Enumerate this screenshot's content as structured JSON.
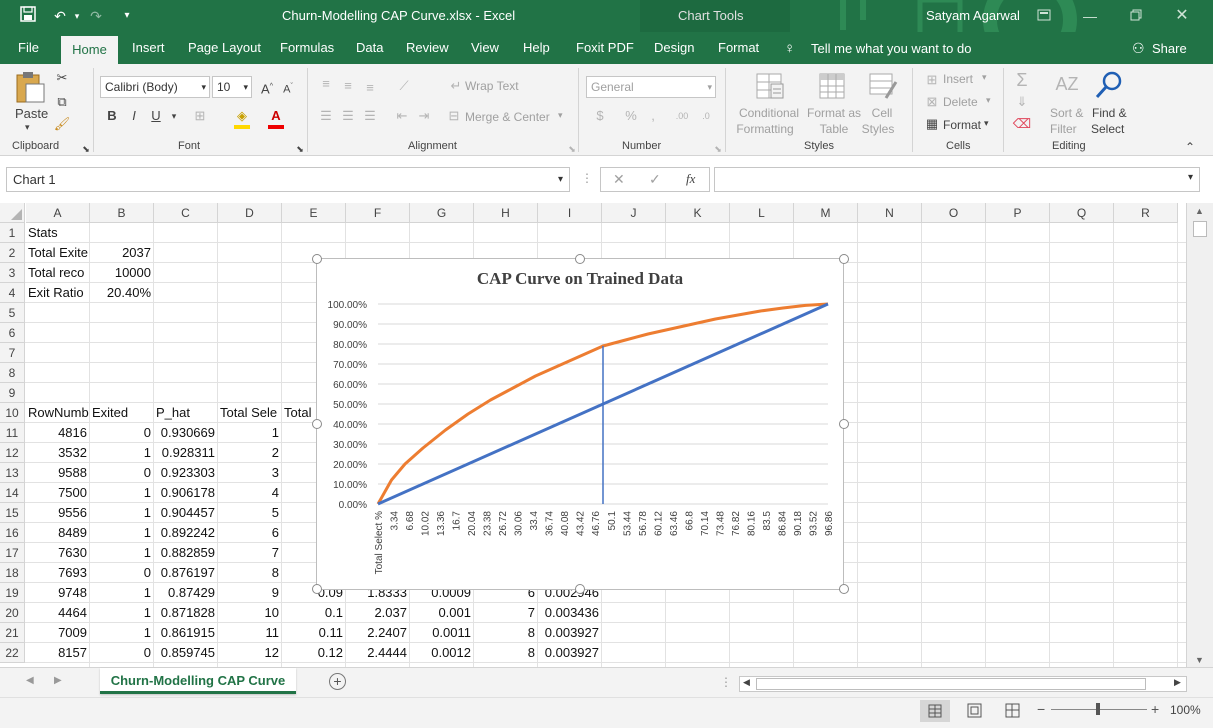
{
  "window": {
    "title": "Churn-Modelling CAP Curve.xlsx  -  Excel",
    "context": "Chart Tools",
    "user": "Satyam Agarwal"
  },
  "tabs": [
    "File",
    "Home",
    "Insert",
    "Page Layout",
    "Formulas",
    "Data",
    "Review",
    "View",
    "Help",
    "Foxit PDF",
    "Design",
    "Format"
  ],
  "tell_me": "Tell me what you want to do",
  "share": "Share",
  "ribbon": {
    "paste": "Paste",
    "clipboard": "Clipboard",
    "font_name": "Calibri (Body)",
    "font_size": "10",
    "font": "Font",
    "wrap_text": "Wrap Text",
    "merge_center": "Merge & Center",
    "alignment": "Alignment",
    "number_format": "General",
    "number": "Number",
    "conditional_formatting": [
      "Conditional",
      "Formatting"
    ],
    "format_as_table": [
      "Format as",
      "Table"
    ],
    "cell_styles": [
      "Cell",
      "Styles"
    ],
    "styles": "Styles",
    "insert": "Insert",
    "delete": "Delete",
    "format": "Format",
    "cells": "Cells",
    "sort_filter": [
      "Sort &",
      "Filter"
    ],
    "find_select": [
      "Find &",
      "Select"
    ],
    "editing": "Editing"
  },
  "formula_bar": {
    "name_box": "Chart 1",
    "fx": "fx",
    "content": ""
  },
  "columns": [
    "A",
    "B",
    "C",
    "D",
    "E",
    "F",
    "G",
    "H",
    "I",
    "J",
    "K",
    "L",
    "M",
    "N",
    "O",
    "P",
    "Q",
    "R"
  ],
  "rows": [
    "1",
    "2",
    "3",
    "4",
    "5",
    "6",
    "7",
    "8",
    "9",
    "10",
    "11",
    "12",
    "13",
    "14",
    "15",
    "16",
    "17",
    "18",
    "19",
    "20",
    "21",
    "22"
  ],
  "cells": {
    "r1": [
      "Stats",
      "",
      "",
      "",
      "",
      "",
      "",
      "",
      ""
    ],
    "r2": [
      "Total Exite",
      "2037",
      "",
      "",
      "",
      "",
      "",
      "",
      ""
    ],
    "r3": [
      "Total reco",
      "10000",
      "",
      "",
      "",
      "",
      "",
      "",
      ""
    ],
    "r4": [
      "Exit Ratio",
      "20.40%",
      "",
      "",
      "",
      "",
      "",
      "",
      ""
    ],
    "r10": [
      "RowNumb",
      "Exited",
      "P_hat",
      "Total Sele",
      "Total",
      "",
      "",
      "",
      ""
    ],
    "r11": [
      "4816",
      "0",
      "0.930669",
      "1",
      "",
      "",
      "",
      "",
      ""
    ],
    "r12": [
      "3532",
      "1",
      "0.928311",
      "2",
      "",
      "",
      "",
      "",
      ""
    ],
    "r13": [
      "9588",
      "0",
      "0.923303",
      "3",
      "",
      "",
      "",
      "",
      ""
    ],
    "r14": [
      "7500",
      "1",
      "0.906178",
      "4",
      "",
      "",
      "",
      "",
      ""
    ],
    "r15": [
      "9556",
      "1",
      "0.904457",
      "5",
      "",
      "",
      "",
      "",
      ""
    ],
    "r16": [
      "8489",
      "1",
      "0.892242",
      "6",
      "",
      "",
      "",
      "",
      ""
    ],
    "r17": [
      "7630",
      "1",
      "0.882859",
      "7",
      "",
      "",
      "",
      "",
      ""
    ],
    "r18": [
      "7693",
      "0",
      "0.876197",
      "8",
      "",
      "",
      "",
      "",
      ""
    ],
    "r19": [
      "9748",
      "1",
      "0.87429",
      "9",
      "0.09",
      "1.8333",
      "0.0009",
      "6",
      "0.002946"
    ],
    "r20": [
      "4464",
      "1",
      "0.871828",
      "10",
      "0.1",
      "2.037",
      "0.001",
      "7",
      "0.003436"
    ],
    "r21": [
      "7009",
      "1",
      "0.861915",
      "11",
      "0.11",
      "2.2407",
      "0.0011",
      "8",
      "0.003927"
    ],
    "r22": [
      "8157",
      "0",
      "0.859745",
      "12",
      "0.12",
      "2.4444",
      "0.0012",
      "8",
      "0.003927"
    ]
  },
  "sheet_tab": "Churn-Modelling CAP Curve",
  "zoom": "100%",
  "chart_data": {
    "type": "line",
    "title": "CAP Curve on Trained Data",
    "y_ticks": [
      "100.00%",
      "90.00%",
      "80.00%",
      "70.00%",
      "60.00%",
      "50.00%",
      "40.00%",
      "30.00%",
      "20.00%",
      "10.00%",
      "0.00%"
    ],
    "x_ticks": [
      "Total Select %",
      "3.34",
      "6.68",
      "10.02",
      "13.36",
      "16.7",
      "20.04",
      "23.38",
      "26.72",
      "30.06",
      "33.4",
      "36.74",
      "40.08",
      "43.42",
      "46.76",
      "50.1",
      "53.44",
      "56.78",
      "60.12",
      "63.46",
      "66.8",
      "70.14",
      "73.48",
      "76.82",
      "80.16",
      "83.5",
      "86.84",
      "90.18",
      "93.52",
      "96.86"
    ],
    "ylim": [
      0,
      100
    ],
    "xlim": [
      0,
      100
    ],
    "series": [
      {
        "color": "#ed7d31",
        "x": [
          0,
          3,
          6,
          10,
          15,
          20,
          25,
          30,
          35,
          40,
          45,
          50,
          55,
          60,
          65,
          70,
          75,
          80,
          85,
          90,
          95,
          100
        ],
        "y": [
          0,
          12,
          20,
          28,
          37,
          45,
          52,
          58,
          64,
          69,
          74,
          79,
          82,
          85,
          87.5,
          90,
          92.5,
          94.5,
          96.5,
          98,
          99.3,
          100
        ]
      },
      {
        "color": "#4472c4",
        "x": [
          0,
          100
        ],
        "y": [
          0,
          100
        ]
      },
      {
        "color": "#4472c4",
        "x": [
          50,
          50
        ],
        "y": [
          0,
          79
        ]
      }
    ]
  }
}
